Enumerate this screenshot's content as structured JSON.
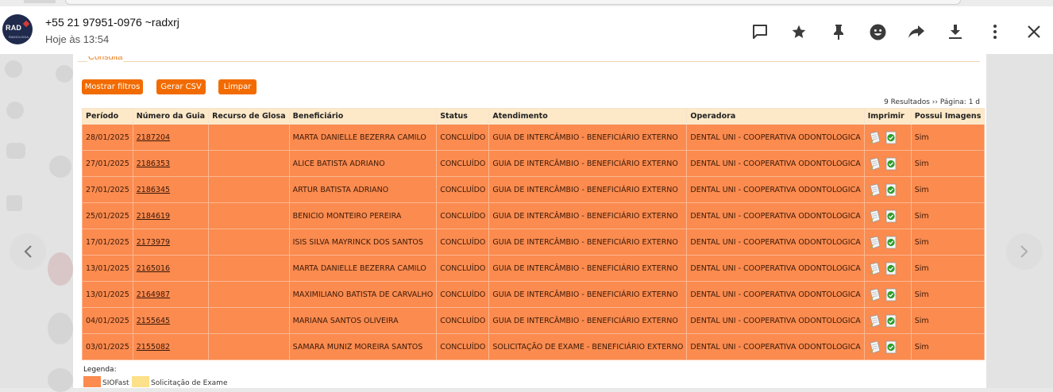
{
  "chat": {
    "avatar_text": "RAD",
    "avatar_subtext": "RADIOLOGIA",
    "sender": "+55 21 97951-0976 ~radxrj",
    "timestamp": "Hoje às 13:54"
  },
  "header_icons": [
    "reply-icon",
    "star-icon",
    "pin-icon",
    "emoji-icon",
    "forward-icon",
    "download-icon",
    "more-icon",
    "close-icon"
  ],
  "panel": {
    "title": "Consulta",
    "buttons": {
      "filters": "Mostrar filtros",
      "csv": "Gerar CSV",
      "clear": "Limpar"
    },
    "results": "9 Resultados ›› Página: 1 d"
  },
  "table": {
    "headers": [
      "Período",
      "Número da Guia",
      "Recurso de Glosa",
      "Beneficiário",
      "Status",
      "Atendimento",
      "Operadora",
      "Imprimir",
      "Possui Imagens"
    ],
    "rows": [
      {
        "periodo": "28/01/2025",
        "guia": "2187204",
        "recurso": "",
        "beneficiario": "MARTA DANIELLE BEZERRA CAMILO",
        "status": "CONCLUÍDO",
        "atendimento": "GUIA DE INTERCÂMBIO - BENEFICIÁRIO EXTERNO",
        "operadora": "DENTAL UNI - COOPERATIVA ODONTOLOGICA",
        "imagens": "Sim"
      },
      {
        "periodo": "27/01/2025",
        "guia": "2186353",
        "recurso": "",
        "beneficiario": "ALICE BATISTA ADRIANO",
        "status": "CONCLUÍDO",
        "atendimento": "GUIA DE INTERCÂMBIO - BENEFICIÁRIO EXTERNO",
        "operadora": "DENTAL UNI - COOPERATIVA ODONTOLOGICA",
        "imagens": "Sim"
      },
      {
        "periodo": "27/01/2025",
        "guia": "2186345",
        "recurso": "",
        "beneficiario": "ARTUR BATISTA ADRIANO",
        "status": "CONCLUÍDO",
        "atendimento": "GUIA DE INTERCÂMBIO - BENEFICIÁRIO EXTERNO",
        "operadora": "DENTAL UNI - COOPERATIVA ODONTOLOGICA",
        "imagens": "Sim"
      },
      {
        "periodo": "25/01/2025",
        "guia": "2184619",
        "recurso": "",
        "beneficiario": "BENICIO MONTEIRO PEREIRA",
        "status": "CONCLUÍDO",
        "atendimento": "GUIA DE INTERCÂMBIO - BENEFICIÁRIO EXTERNO",
        "operadora": "DENTAL UNI - COOPERATIVA ODONTOLOGICA",
        "imagens": "Sim"
      },
      {
        "periodo": "17/01/2025",
        "guia": "2173979",
        "recurso": "",
        "beneficiario": "ISIS SILVA MAYRINCK DOS SANTOS",
        "status": "CONCLUÍDO",
        "atendimento": "GUIA DE INTERCÂMBIO - BENEFICIÁRIO EXTERNO",
        "operadora": "DENTAL UNI - COOPERATIVA ODONTOLOGICA",
        "imagens": "Sim"
      },
      {
        "periodo": "13/01/2025",
        "guia": "2165016",
        "recurso": "",
        "beneficiario": "MARTA DANIELLE BEZERRA CAMILO",
        "status": "CONCLUÍDO",
        "atendimento": "GUIA DE INTERCÂMBIO - BENEFICIÁRIO EXTERNO",
        "operadora": "DENTAL UNI - COOPERATIVA ODONTOLOGICA",
        "imagens": "Sim"
      },
      {
        "periodo": "13/01/2025",
        "guia": "2164987",
        "recurso": "",
        "beneficiario": "MAXIMILIANO BATISTA DE CARVALHO",
        "status": "CONCLUÍDO",
        "atendimento": "GUIA DE INTERCÂMBIO - BENEFICIÁRIO EXTERNO",
        "operadora": "DENTAL UNI - COOPERATIVA ODONTOLOGICA",
        "imagens": "Sim"
      },
      {
        "periodo": "04/01/2025",
        "guia": "2155645",
        "recurso": "",
        "beneficiario": "MARIANA SANTOS OLIVEIRA",
        "status": "CONCLUÍDO",
        "atendimento": "GUIA DE INTERCÂMBIO - BENEFICIÁRIO EXTERNO",
        "operadora": "DENTAL UNI - COOPERATIVA ODONTOLOGICA",
        "imagens": "Sim"
      },
      {
        "periodo": "03/01/2025",
        "guia": "2155082",
        "recurso": "",
        "beneficiario": "SAMARA MUNIZ MOREIRA SANTOS",
        "status": "CONCLUÍDO",
        "atendimento": "SOLICITAÇÃO DE EXAME - BENEFICIÁRIO EXTERNO",
        "operadora": "DENTAL UNI - COOPERATIVA ODONTOLOGICA",
        "imagens": "Sim"
      }
    ]
  },
  "legend": {
    "label": "Legenda:",
    "items": [
      {
        "label": "SIOFast",
        "color": "#fb8b4f"
      },
      {
        "label": "Solicitação de Exame",
        "color": "#fde08a"
      }
    ]
  },
  "colors": {
    "row": "#fb8b4f",
    "header_row": "#fde9c8",
    "button": "#f26b00",
    "accent": "#f07c1c"
  }
}
